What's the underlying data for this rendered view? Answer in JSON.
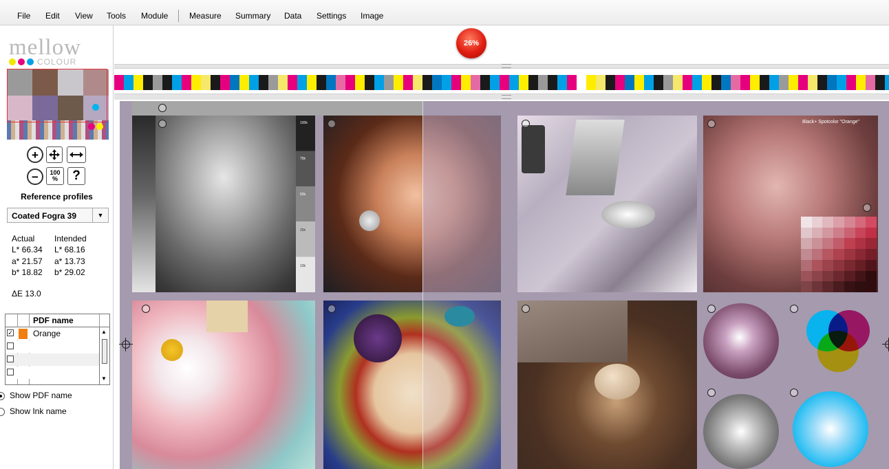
{
  "menu": {
    "items": [
      "File",
      "Edit",
      "View",
      "Tools",
      "Module",
      "Measure",
      "Summary",
      "Data",
      "Settings",
      "Image"
    ]
  },
  "logo": {
    "name": "mellow",
    "sub": "COLOUR"
  },
  "zoom": {
    "in": "+",
    "out": "−",
    "fit": "100 %",
    "help": "?"
  },
  "reference": {
    "title": "Reference profiles",
    "profile": "Coated Fogra 39"
  },
  "measure": {
    "actual_label": "Actual",
    "intended_label": "Intended",
    "actual": {
      "L": "L* 66.34",
      "a": "a* 21.57",
      "b": "b* 18.82"
    },
    "intended": {
      "L": "L* 68.16",
      "a": "a* 13.73",
      "b": "b* 29.02"
    },
    "delta_e": "ΔE  13.0"
  },
  "table": {
    "header": "PDF name",
    "rows": [
      {
        "name": "Orange",
        "checked": true,
        "color": "#f07f12"
      },
      {
        "name": "",
        "checked": false,
        "color": ""
      },
      {
        "name": "",
        "checked": false,
        "color": ""
      },
      {
        "name": "",
        "checked": false,
        "color": ""
      }
    ]
  },
  "display_options": {
    "show_pdf_name": "Show PDF name",
    "show_ink_name": "Show Ink name",
    "selected": "show_pdf_name"
  },
  "progress_badge": "26%",
  "canvas": {
    "patch_caption": "Black+ Spotcolor \"Orange\"",
    "step_labels": [
      "100k",
      "75k",
      "50k",
      "25k",
      "10k"
    ]
  },
  "colors": {
    "accent_red": "#e01e12",
    "canvas_tint": "#a59aae",
    "cyan": "#00b4f0",
    "magenta": "#e6007e",
    "yellow": "#ffed00"
  }
}
